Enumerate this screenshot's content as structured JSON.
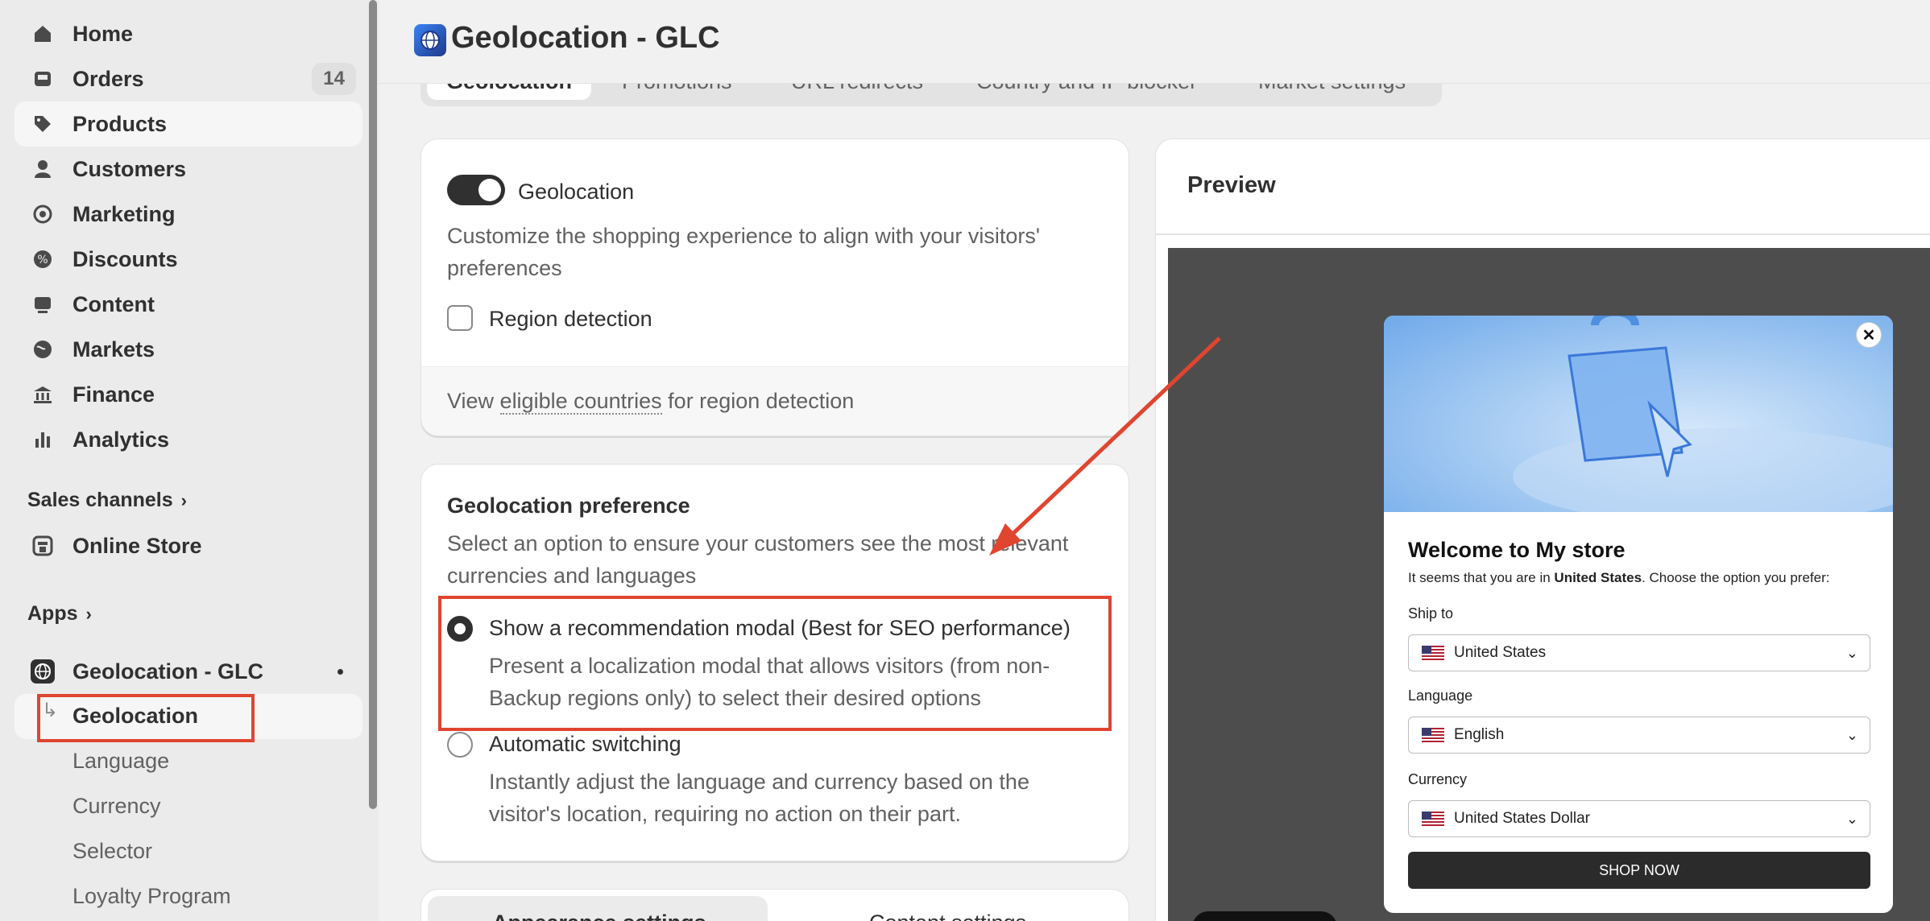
{
  "sidebar": {
    "nav": [
      {
        "label": "Home",
        "icon": "home-icon"
      },
      {
        "label": "Orders",
        "icon": "inbox-icon",
        "badge": "14"
      },
      {
        "label": "Products",
        "icon": "tag-icon"
      },
      {
        "label": "Customers",
        "icon": "person-icon"
      },
      {
        "label": "Marketing",
        "icon": "target-icon"
      },
      {
        "label": "Discounts",
        "icon": "discount-icon"
      },
      {
        "label": "Content",
        "icon": "content-icon"
      },
      {
        "label": "Markets",
        "icon": "globe-icon"
      },
      {
        "label": "Finance",
        "icon": "bank-icon"
      },
      {
        "label": "Analytics",
        "icon": "bar-chart-icon"
      }
    ],
    "sales_channels_label": "Sales channels",
    "online_store_label": "Online Store",
    "apps_label": "Apps",
    "app_name": "Geolocation - GLC",
    "app_subitems": [
      "Geolocation",
      "Language",
      "Currency",
      "Selector",
      "Loyalty Program"
    ]
  },
  "header": {
    "title": "Geolocation - GLC"
  },
  "tabs": [
    "Geolocation",
    "Promotions",
    "URL redirects",
    "Country and IP blocker",
    "Market settings"
  ],
  "geolocation_card": {
    "toggle_label": "Geolocation",
    "description": "Customize the shopping experience to align with your visitors' preferences",
    "region_detection_label": "Region detection",
    "footer_text_prefix": "View ",
    "footer_link": "eligible countries",
    "footer_text_suffix": " for region detection"
  },
  "preference_card": {
    "title": "Geolocation preference",
    "description": "Select an option to ensure your customers see the most relevant currencies and languages",
    "option1_label": "Show a recommendation modal (Best for SEO performance)",
    "option1_desc": "Present a localization modal that allows visitors (from non-Backup regions only) to select their desired options",
    "option2_label": "Automatic switching",
    "option2_desc": "Instantly adjust the language and currency based on the visitor's location, requiring no action on their part."
  },
  "settings_tabs": [
    "Appearance settings",
    "Content settings"
  ],
  "preview": {
    "title": "Preview",
    "modal": {
      "heading": "Welcome to My store",
      "sub_prefix": "It seems that you are in ",
      "sub_country": "United States",
      "sub_suffix": ". Choose the option you prefer:",
      "ship_label": "Ship to",
      "ship_value": "United States",
      "language_label": "Language",
      "language_value": "English",
      "currency_label": "Currency",
      "currency_value": "United States Dollar",
      "button_label": "SHOP NOW"
    }
  },
  "colors": {
    "annotation": "#e0452f",
    "accent_dark": "#303030"
  }
}
